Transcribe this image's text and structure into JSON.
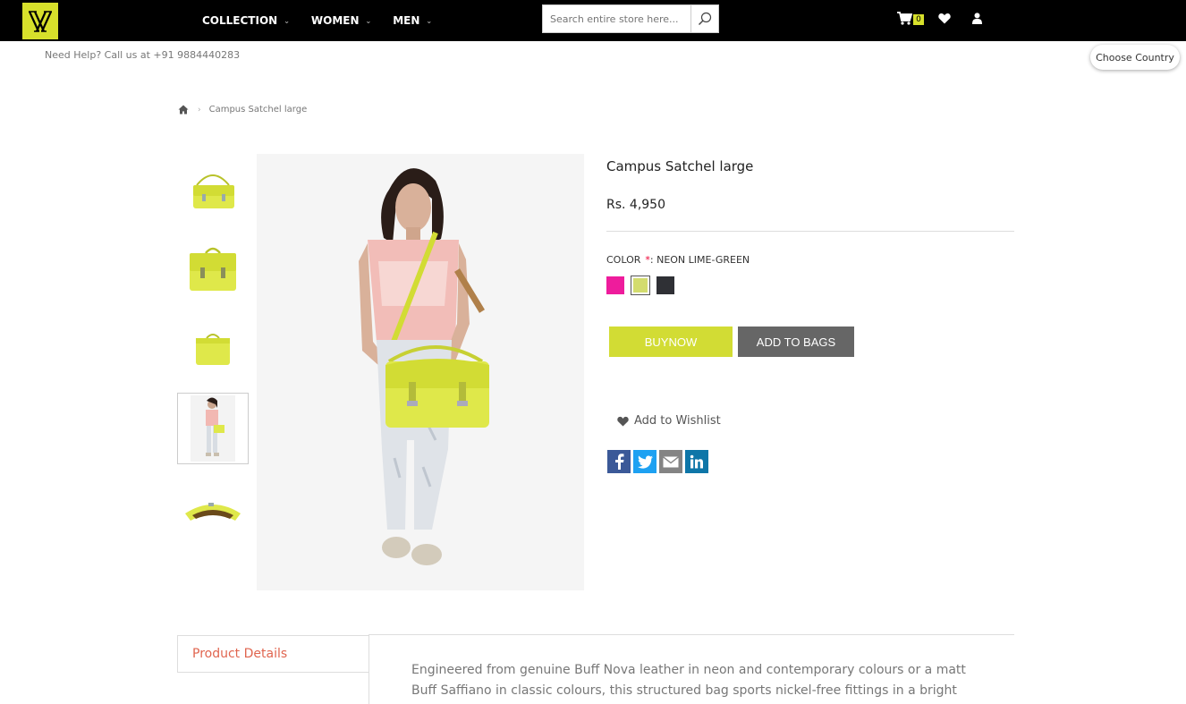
{
  "header": {
    "logo_alt": "brand-logo",
    "nav": [
      {
        "label": "COLLECTION"
      },
      {
        "label": "WOMEN"
      },
      {
        "label": "MEN"
      }
    ],
    "search": {
      "placeholder": "Search entire store here..."
    },
    "cart_count": "0"
  },
  "help_text": "Need Help? Call us at +91 9884440283",
  "choose_country": "Choose Country",
  "breadcrumb": {
    "current": "Campus Satchel large"
  },
  "product": {
    "title": "Campus Satchel large",
    "price": "Rs. 4,950",
    "color_label": "COLOR",
    "color_required": "*",
    "color_value": ": NEON LIME-GREEN",
    "swatches": [
      {
        "name": "pink",
        "color": "#ee1c9c"
      },
      {
        "name": "neon-lime-green",
        "color": "#d3dc6e",
        "selected": true
      },
      {
        "name": "black",
        "color": "#2f3035"
      }
    ],
    "buy_now": "BUYNOW",
    "add_to_bags": "ADD TO BAGS",
    "wishlist": "Add to Wishlist",
    "accent_color": "#d2dc34"
  },
  "tabs": {
    "active": "Product Details"
  },
  "description": "Engineered from genuine Buff Nova leather in neon and contemporary colours or a matt Buff Saffiano in classic colours, this structured bag sports nickel-free fittings in a bright silver finish."
}
